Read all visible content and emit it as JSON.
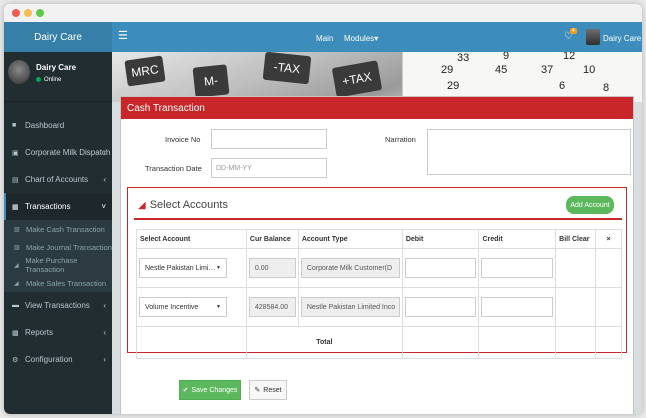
{
  "app": {
    "brand": "Dairy Care"
  },
  "topbar": {
    "menu_icon": "hamburger-icon",
    "nav": [
      {
        "label": "Main"
      },
      {
        "label": "Modules"
      }
    ],
    "notifications": {
      "icon": "bell-icon",
      "count": "4"
    },
    "user_name": "Dairy Care"
  },
  "sidebar": {
    "user": {
      "name": "Dairy Care",
      "status": "Online"
    },
    "items": [
      {
        "label": "Dashboard",
        "icon": "dashboard-icon"
      },
      {
        "label": "Corporate Milk Dispatch",
        "icon": "truck-icon"
      },
      {
        "label": "Chart of Accounts",
        "icon": "chart-icon"
      },
      {
        "label": "Transactions",
        "icon": "exchange-icon",
        "active": true
      },
      {
        "label": "View Transactions",
        "icon": "list-icon"
      },
      {
        "label": "Reports",
        "icon": "reports-icon"
      },
      {
        "label": "Configuration",
        "icon": "gear-icon"
      }
    ],
    "submenu": [
      {
        "label": "Make Cash Transaction",
        "icon": "document-icon"
      },
      {
        "label": "Make Journal Transaction",
        "icon": "document-icon"
      },
      {
        "label": "Make Purchase Transaction",
        "icon": "cart-icon"
      },
      {
        "label": "Make Sales Transaction",
        "icon": "cart-icon"
      }
    ]
  },
  "panel": {
    "title": "Cash Transaction",
    "invoice_label": "Invoice No",
    "invoice_value": "",
    "date_label": "Transaction Date",
    "date_placeholder": "DD-MM-YY",
    "narration_label": "Narration",
    "narration_value": ""
  },
  "accounts": {
    "title": "Select Accounts",
    "add_button": "Add Account",
    "columns": [
      "Select Account",
      "Cur Balance",
      "Account Type",
      "Debit",
      "Credit",
      "Bill Clear",
      "×"
    ],
    "rows": [
      {
        "account": "Nestle Pakistan Limi…",
        "balance": "0.00",
        "type": "Corporate Milk Customer(D",
        "debit": "",
        "credit": ""
      },
      {
        "account": "Volume Incentive",
        "balance": "428584.00",
        "type": "Nestle Pakistan Limited Inco",
        "debit": "",
        "credit": ""
      }
    ],
    "total_label": "Total"
  },
  "actions": {
    "save": "Save Changes",
    "reset": "Reset"
  },
  "colors": {
    "topbar": "#3c8dbc",
    "sidebar": "#222d32",
    "panel_header": "#c9262a",
    "success": "#5cb85c"
  }
}
